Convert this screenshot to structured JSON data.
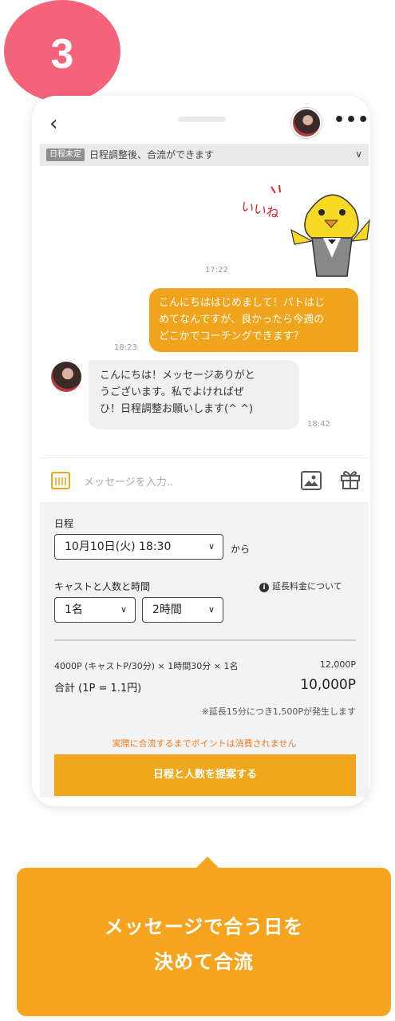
{
  "step": "3",
  "header": {
    "back_icon": "chevron-left-icon",
    "more_icon": "more-icon"
  },
  "status": {
    "badge": "日程未定",
    "text": "日程調整後、合流ができます"
  },
  "chat": {
    "sticker_text": "いいね",
    "messages": [
      {
        "time": "17:22"
      },
      {
        "lines": [
          "こんにちははじめまして！パトはじ",
          "めてなんですが、良かったら今週の",
          "どこかでコーチングできます？"
        ],
        "time": "18:23"
      },
      {
        "lines": [
          "こんにちは！メッセージありがと",
          "うございます。私でよければぜ",
          "ひ！日程調整お願いします(^ ^)"
        ],
        "time": "18:42"
      }
    ]
  },
  "composer": {
    "placeholder": "メッセージを入力.."
  },
  "form": {
    "schedule_label": "日程",
    "date_value": "10月10日(火)  18:30",
    "from_label": "から",
    "cast_label": "キャストと人数と時間",
    "extension_info": "延長料金について",
    "people_value": "1名",
    "hours_value": "2時間",
    "calc_line": "4000P (キャストP/30分) × 1時間30分 × 1名",
    "calc_amount": "12,000P",
    "total_label": "合計 (1P = 1.1円)",
    "total_amount": "10,000P",
    "note": "※延長15分につき1,500Pが発生します",
    "warning": "実際に合流するまでポイントは消費されません",
    "submit": "日程と人数を提案する"
  },
  "callout": {
    "line1": "メッセージで合う日を",
    "line2": "決めて合流"
  },
  "colors": {
    "accent": "#f0a41b",
    "badge": "#f5637b",
    "warning": "#f07b1e"
  }
}
